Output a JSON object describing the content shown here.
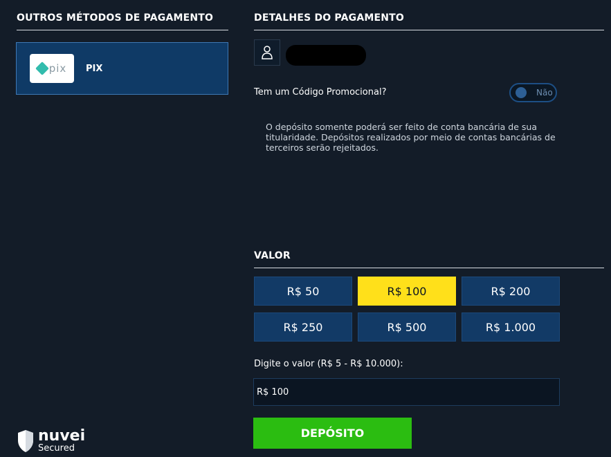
{
  "left": {
    "title": "OUTROS MÉTODOS DE PAGAMENTO",
    "methods": [
      {
        "logo_text": "pix",
        "label": "PIX",
        "icon": "pix-logo-icon"
      }
    ],
    "footer": {
      "brand": "nuvei",
      "secured": "Secured",
      "icon": "shield-icon"
    }
  },
  "right": {
    "title": "DETALHES DO PAGAMENTO",
    "user_icon": "user-icon",
    "promo": {
      "label": "Tem um Código Promocional?",
      "toggle_label": "Não"
    },
    "notice": "O depósito somente poderá ser feito de conta bancária de sua titularidade. Depósitos realizados por meio de contas bancárias de terceiros serão rejeitados.",
    "value": {
      "title": "VALOR",
      "amounts": [
        "R$ 50",
        "R$ 100",
        "R$ 200",
        "R$ 250",
        "R$ 500",
        "R$ 1.000"
      ],
      "selected": "R$ 100",
      "range_label": "Digite o valor (R$ 5 - R$ 10.000):",
      "input_value": "R$ 100"
    },
    "deposit_label": "DEPÓSITO"
  },
  "colors": {
    "background": "#131c28",
    "card": "#0f3a66",
    "amount_button": "#123a66",
    "selected_amount": "#ffe01a",
    "deposit_button": "#2bbd11",
    "pix_teal": "#32bcad"
  }
}
